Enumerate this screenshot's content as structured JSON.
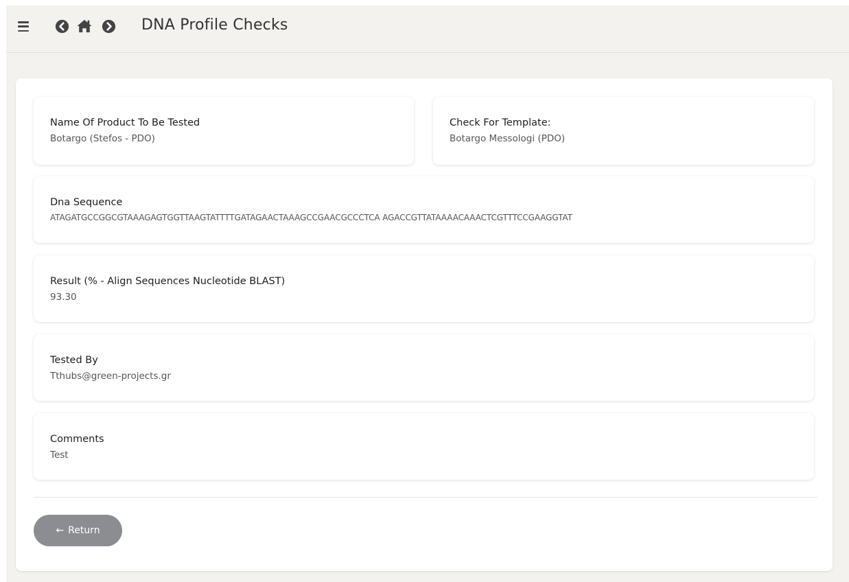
{
  "header": {
    "title": "DNA Profile Checks",
    "icons": [
      "menu-icon",
      "circle-chevron-left-icon",
      "home-icon",
      "circle-chevron-right-icon"
    ]
  },
  "fields": {
    "product_name": {
      "label": "Name Of Product To Be Tested",
      "value": "Botargo (Stefos - PDO)"
    },
    "template": {
      "label": "Check For Template:",
      "value": "Botargo Messologi (PDO)"
    },
    "dna_sequence": {
      "label": "Dna Sequence",
      "value": "ATAGATGCCGGCGTAAAGAGTGGTTAAGTATTTTGATAGAACTAAAGCCGAACGCCCTCA AGACCGTTATAAAACAAACTCGTTTCCGAAGGTAT"
    },
    "result": {
      "label": "Result (% - Align Sequences Nucleotide BLAST)",
      "value": "93.30"
    },
    "tested_by": {
      "label": "Tested By",
      "value": "Tthubs@green-projects.gr"
    },
    "comments": {
      "label": "Comments",
      "value": "Test"
    }
  },
  "actions": {
    "return_icon": "←",
    "return_label": "Return"
  },
  "colors": {
    "app_background": "#f4f2ef",
    "card_background": "#ffffff",
    "return_button": "#8b8d91"
  }
}
